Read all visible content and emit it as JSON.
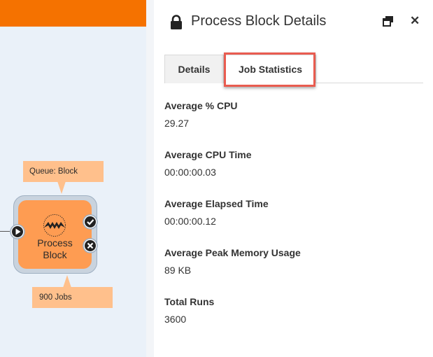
{
  "canvas": {
    "queue_callout": "Queue: Block",
    "jobs_callout": "900 Jobs",
    "node": {
      "title_line1": "Process",
      "title_line2": "Block"
    }
  },
  "panel": {
    "title": "Process Block Details",
    "tabs": [
      {
        "label": "Details",
        "active": false
      },
      {
        "label": "Job Statistics",
        "active": true
      }
    ],
    "stats": [
      {
        "label": "Average % CPU",
        "value": "29.27"
      },
      {
        "label": "Average CPU Time",
        "value": "00:00:00.03"
      },
      {
        "label": "Average Elapsed Time",
        "value": "00:00:00.12"
      },
      {
        "label": "Average Peak Memory Usage",
        "value": "89 KB"
      },
      {
        "label": "Total Runs",
        "value": "3600"
      }
    ]
  },
  "colors": {
    "accent_orange": "#f57200",
    "node_fill": "#fe9c52",
    "callout_fill": "#ffc08c",
    "highlight_red": "#e95c50",
    "canvas_bg": "#eaf1f9"
  },
  "icons": [
    "lock-icon",
    "popout-icon",
    "close-icon",
    "fme-logo-icon",
    "play-port-icon",
    "checkmark-port-icon",
    "x-port-icon"
  ]
}
